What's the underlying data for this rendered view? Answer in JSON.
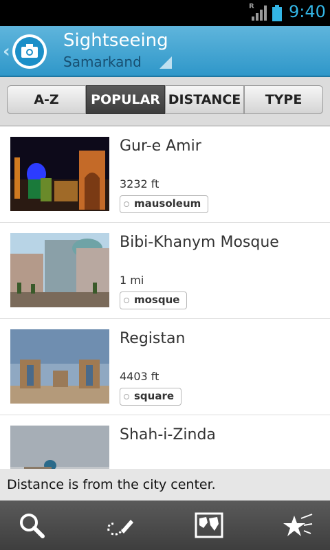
{
  "status_bar": {
    "roaming_indicator": "R",
    "time": "9:40",
    "icons": [
      "signal-icon",
      "battery-icon"
    ],
    "accent": "#33b5e5"
  },
  "header": {
    "title": "Sightseeing",
    "subtitle": "Samarkand",
    "icons": [
      "back-chevron-icon",
      "camera-icon",
      "dropdown-triangle-icon"
    ],
    "bar_color": "#3aa3d4"
  },
  "tabs": [
    {
      "label": "A-Z",
      "active": false
    },
    {
      "label": "POPULAR",
      "active": true
    },
    {
      "label": "DISTANCE",
      "active": false
    },
    {
      "label": "TYPE",
      "active": false
    }
  ],
  "places": [
    {
      "name": "Gur-e Amir",
      "distance": "3232 ft",
      "tag": "mausoleum"
    },
    {
      "name": "Bibi-Khanym Mosque",
      "distance": "1 mi",
      "tag": "mosque"
    },
    {
      "name": "Registan",
      "distance": "4403 ft",
      "tag": "square"
    },
    {
      "name": "Shah-i-Zinda",
      "distance": "",
      "tag": ""
    }
  ],
  "footer_note": "Distance is from the city center.",
  "bottom_bar": {
    "icons": [
      "search-icon",
      "route-pen-icon",
      "map-icon",
      "favorites-star-icon"
    ]
  }
}
